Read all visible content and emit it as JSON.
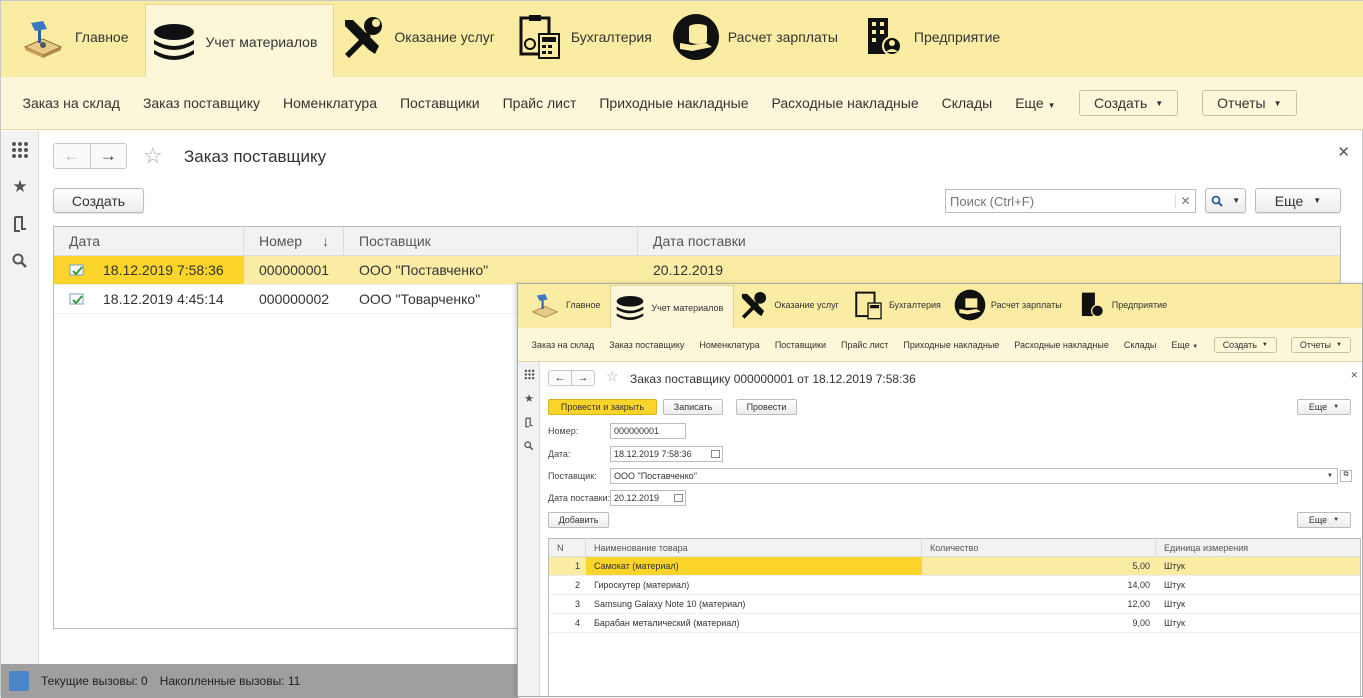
{
  "sections": [
    {
      "label": "Главное",
      "icon": "desk-lamp-icon"
    },
    {
      "label": "Учет материалов",
      "icon": "layers-icon"
    },
    {
      "label": "Оказание услуг",
      "icon": "tools-icon"
    },
    {
      "label": "Бухгалтерия",
      "icon": "calculator-icon"
    },
    {
      "label": "Расчет зарплаты",
      "icon": "coins-hand-icon"
    },
    {
      "label": "Предприятие",
      "icon": "building-icon"
    }
  ],
  "nav": {
    "items": [
      "Заказ на склад",
      "Заказ поставщику",
      "Номенклатура",
      "Поставщики",
      "Прайс лист",
      "Приходные накладные",
      "Расходные накладные",
      "Склады"
    ],
    "more": "Еще",
    "create": "Создать",
    "reports": "Отчеты"
  },
  "list_form": {
    "title": "Заказ поставщику",
    "create_button": "Создать",
    "search_placeholder": "Поиск (Ctrl+F)",
    "more_button": "Еще",
    "columns": [
      "Дата",
      "Номер",
      "Поставщик",
      "Дата поставки"
    ],
    "sort_indicator": "↓",
    "rows": [
      {
        "date": "18.12.2019 7:58:36",
        "number": "000000001",
        "supplier": "ООО \"Поставченко\"",
        "delivery": "20.12.2019"
      },
      {
        "date": "18.12.2019 4:45:14",
        "number": "000000002",
        "supplier": "ООО \"Товарченко\"",
        "delivery": ""
      }
    ]
  },
  "status_bar": {
    "current_calls": "Текущие вызовы: 0",
    "accumulated_calls": "Накопленные вызовы: 11"
  },
  "doc_form": {
    "title": "Заказ поставщику 000000001 от 18.12.2019 7:58:36",
    "post_close_button": "Провести и закрыть",
    "save_button": "Записать",
    "post_button": "Провести",
    "more_button": "Еще",
    "labels": {
      "number": "Номер:",
      "date": "Дата:",
      "supplier": "Поставщик:",
      "delivery": "Дата поставки:"
    },
    "values": {
      "number": "000000001",
      "date": "18.12.2019  7:58:36",
      "supplier": "ООО \"Поставченко\"",
      "delivery": "20.12.2019"
    },
    "add_button": "Добавить",
    "table_more_button": "Еще",
    "columns": [
      "N",
      "Наименование товара",
      "Количество",
      "Единица измерения"
    ],
    "rows": [
      {
        "n": "1",
        "name": "Самокат (материал)",
        "qty": "5,00",
        "unit": "Штук"
      },
      {
        "n": "2",
        "name": "Гироскутер (материал)",
        "qty": "14,00",
        "unit": "Штук"
      },
      {
        "n": "3",
        "name": "Samsung Galaxy Note 10 (материал)",
        "qty": "12,00",
        "unit": "Штук"
      },
      {
        "n": "4",
        "name": "Барабан металический (материал)",
        "qty": "9,00",
        "unit": "Штук"
      }
    ]
  },
  "colors": {
    "section_bg": "#fbeca3",
    "nav_bg": "#fdf7d9",
    "selection": "#fad32b",
    "row_highlight": "#fbeca3"
  }
}
